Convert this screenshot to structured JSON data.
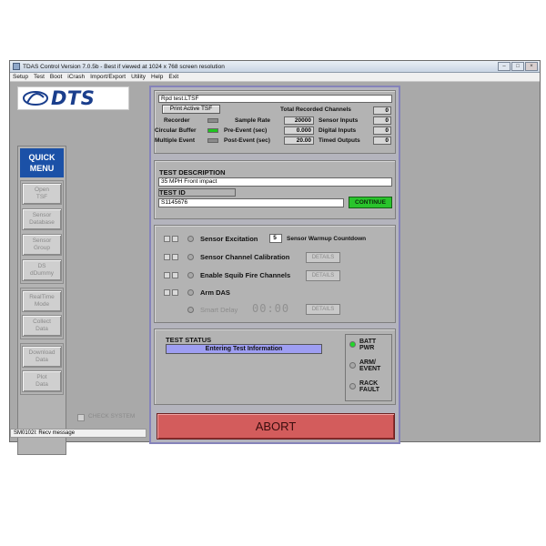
{
  "window": {
    "title": "TDAS Control Version 7.0.5b  -  Best if viewed at 1024 x 768 screen resolution"
  },
  "menu": [
    "Setup",
    "Test",
    "Boot",
    "iCrash",
    "Import/Export",
    "Utility",
    "Help",
    "Exit"
  ],
  "logo": {
    "text": "DTS"
  },
  "quick_menu": {
    "title_line1": "QUICK",
    "title_line2": "MENU",
    "buttons": [
      {
        "l1": "Open",
        "l2": "TSF"
      },
      {
        "l1": "Sensor",
        "l2": "Database"
      },
      {
        "l1": "Sensor",
        "l2": "Group"
      },
      {
        "l1": "DS",
        "l2": "dDummy"
      },
      {
        "l1": "RealTime",
        "l2": "Mode"
      },
      {
        "l1": "Collect",
        "l2": "Data"
      },
      {
        "l1": "Download",
        "l2": "Data"
      },
      {
        "l1": "Plot",
        "l2": "Data"
      }
    ]
  },
  "check_system_label": "CHECK SYSTEM",
  "status_bar": {
    "text": "SM0102I: Recv message"
  },
  "setup_panel": {
    "file_field": "Rpd test.LTSF",
    "print_button": "Print Active TSF",
    "total_channels_label": "Total Recorded Channels",
    "total_channels_value": "0",
    "recorder_label": "Recorder",
    "circular_buffer_label": "Circular Buffer",
    "multiple_event_label": "Multiple Event",
    "sample_rate_label": "Sample Rate",
    "sample_rate_value": "20000",
    "pre_event_label": "Pre-Event (sec)",
    "pre_event_value": "0.000",
    "post_event_label": "Post-Event (sec)",
    "post_event_value": "20.00",
    "sensor_inputs_label": "Sensor Inputs",
    "sensor_inputs_value": "0",
    "digital_inputs_label": "Digital Inputs",
    "digital_inputs_value": "0",
    "timed_outputs_label": "Timed Outputs",
    "timed_outputs_value": "0"
  },
  "test_panel": {
    "description_label": "TEST DESCRIPTION",
    "description_value": "35 MPH Front impact",
    "id_label": "TEST ID",
    "id_value": "S1145676",
    "continue_label": "CONTINUE"
  },
  "steps_panel": {
    "sensor_excitation_label": "Sensor Excitation",
    "warmup_value": "5",
    "warmup_label": "Sensor Warmup Countdown",
    "sensor_calibration_label": "Sensor Channel Calibration",
    "squib_label": "Enable Squib Fire Channels",
    "arm_label": "Arm DAS",
    "smart_delay_label": "Smart Delay",
    "countdown_digits": "00:00",
    "details_label": "DETAILS"
  },
  "status_panel": {
    "title": "TEST STATUS",
    "status_value": "Entering Test Information",
    "batt_l1": "BATT",
    "batt_l2": "PWR",
    "arm_l1": "ARM/",
    "arm_l2": "EVENT",
    "rack_l1": "RACK",
    "rack_l2": "FAULT"
  },
  "abort_label": "ABORT",
  "colors": {
    "accent_blue": "#1b51a7",
    "continue_green": "#29c42c",
    "abort_red": "#d35c5c",
    "status_field": "#9e9ef2"
  }
}
